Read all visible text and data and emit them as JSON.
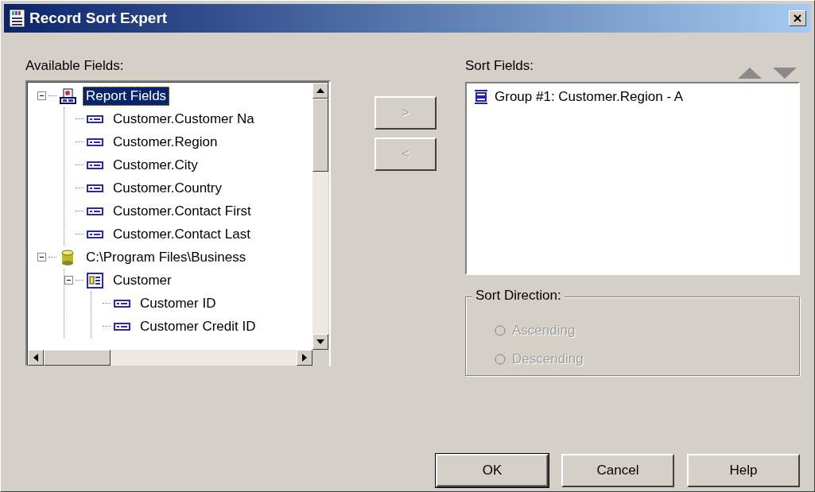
{
  "window": {
    "title": "Record Sort Expert"
  },
  "available_fields": {
    "label": "Available Fields:",
    "tree": [
      {
        "label": "Report Fields",
        "kind": "report",
        "expanded": true,
        "selected": true,
        "children": [
          {
            "label": "Customer.Customer Na",
            "kind": "field",
            "selected": false
          },
          {
            "label": "Customer.Region",
            "kind": "field",
            "selected": false
          },
          {
            "label": "Customer.City",
            "kind": "field",
            "selected": false
          },
          {
            "label": "Customer.Country",
            "kind": "field",
            "selected": false
          },
          {
            "label": "Customer.Contact First",
            "kind": "field",
            "selected": false
          },
          {
            "label": "Customer.Contact Last",
            "kind": "field",
            "selected": false
          }
        ]
      },
      {
        "label": "C:\\Program Files\\Business",
        "kind": "database",
        "expanded": true,
        "selected": false,
        "children": [
          {
            "label": "Customer",
            "kind": "table",
            "expanded": true,
            "selected": false,
            "children": [
              {
                "label": "Customer ID",
                "kind": "field",
                "selected": false
              },
              {
                "label": "Customer Credit ID",
                "kind": "field",
                "selected": false
              }
            ]
          }
        ]
      }
    ]
  },
  "move_buttons": [
    {
      "label": ">",
      "disabled": true
    },
    {
      "label": "<",
      "disabled": true
    }
  ],
  "sort_fields": {
    "label": "Sort Fields:",
    "items": [
      {
        "label": "Group #1: Customer.Region - A",
        "kind": "group",
        "selected": false
      }
    ]
  },
  "sort_direction": {
    "label": "Sort Direction:",
    "disabled": true,
    "options": [
      {
        "label": "Ascending",
        "selected": false
      },
      {
        "label": "Descending",
        "selected": false
      }
    ]
  },
  "buttons": [
    {
      "label": "OK",
      "default": true
    },
    {
      "label": "Cancel",
      "default": false
    },
    {
      "label": "Help",
      "default": false
    }
  ]
}
